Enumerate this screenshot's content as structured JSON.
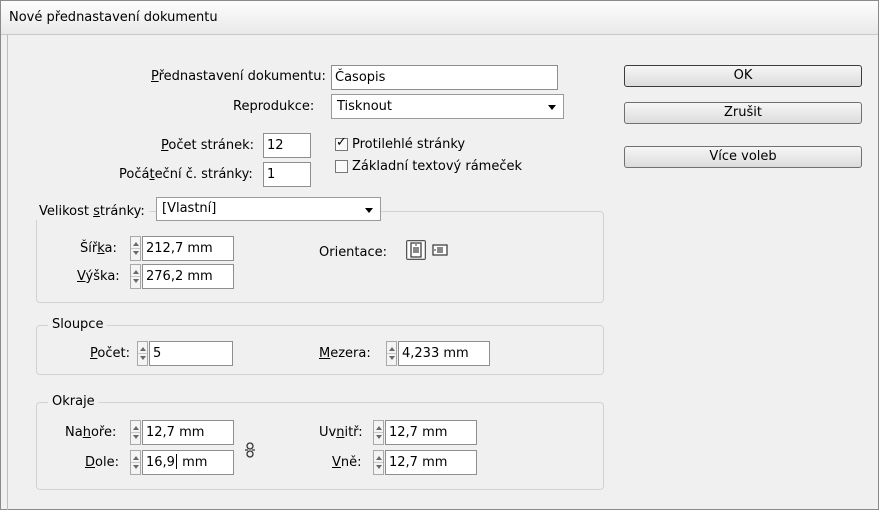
{
  "window": {
    "title": "Nové přednastavení dokumentu"
  },
  "preset": {
    "label": "Přednastavení dokumentu:",
    "value": "Časopis"
  },
  "intent": {
    "label": "Reprodukce:",
    "value": "Tisknout"
  },
  "pages": {
    "count_label": "Počet stránek:",
    "count_value": "12",
    "start_label": "Počáteční č. stránky:",
    "start_value": "1",
    "facing_label": "Protilehlé stránky",
    "facing_checked": true,
    "master_frame_label": "Základní textový rámeček",
    "master_frame_checked": false
  },
  "page_size": {
    "group_label": "Velikost stránky:",
    "value": "[Vlastní]",
    "width_label": "Šířka:",
    "width_value": "212,7 mm",
    "height_label": "Výška:",
    "height_value": "276,2 mm",
    "orientation_label": "Orientace:",
    "orientation_selected": "portrait"
  },
  "columns": {
    "group_label": "Sloupce",
    "number_label": "Počet:",
    "number_value": "5",
    "gutter_label": "Mezera:",
    "gutter_value": "4,233 mm"
  },
  "margins": {
    "group_label": "Okraje",
    "top_label": "Nahoře:",
    "top_value": "12,7 mm",
    "bottom_label": "Dole:",
    "bottom_value_before": "16,9",
    "bottom_value_after": " mm",
    "inside_label": "Uvnitř:",
    "inside_value": "12,7 mm",
    "outside_label": "Vně:",
    "outside_value": "12,7 mm"
  },
  "buttons": {
    "ok": "OK",
    "cancel": "Zrušit",
    "more": "Více voleb"
  },
  "icons": [
    "portrait-orientation-icon",
    "landscape-orientation-icon",
    "chain-link-icon",
    "checkmark-icon",
    "chevron-down-icon"
  ]
}
